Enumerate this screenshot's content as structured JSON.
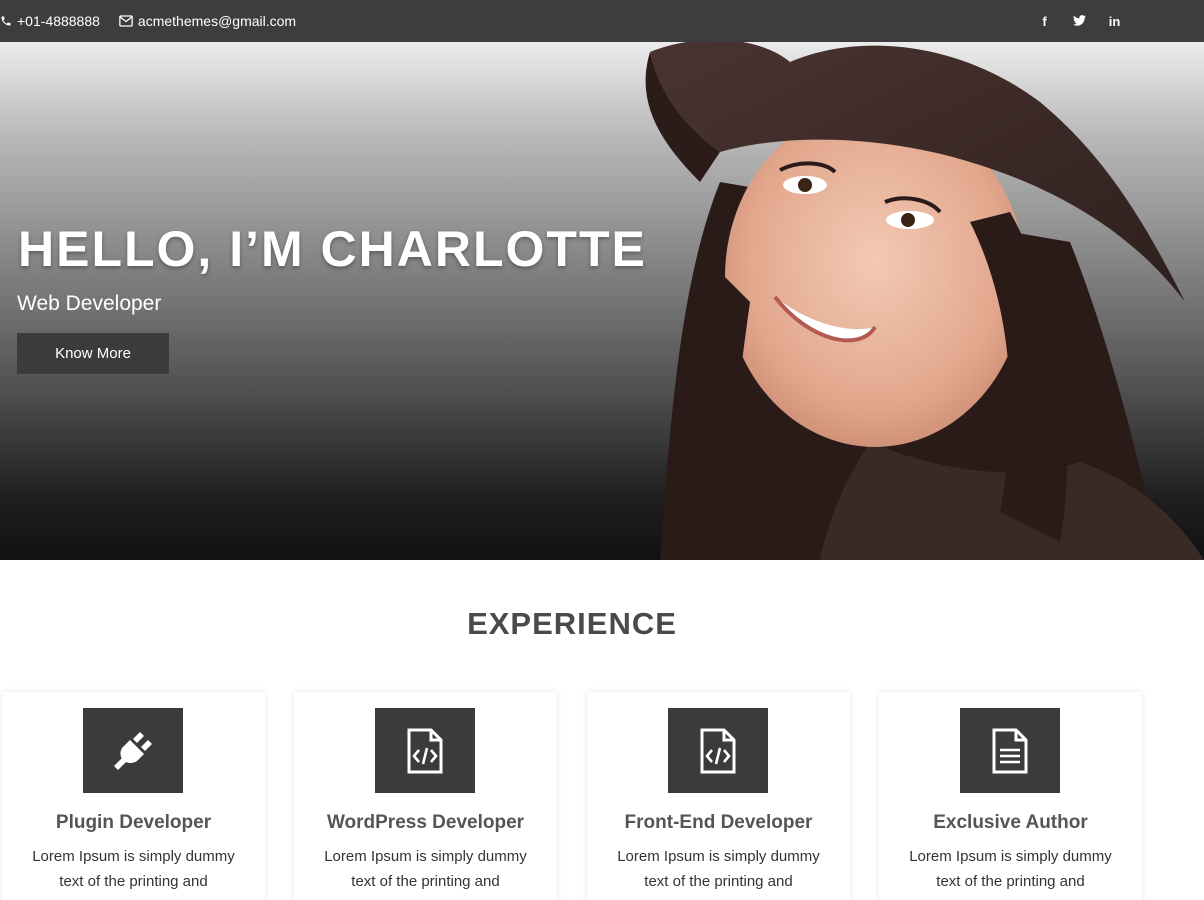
{
  "topbar": {
    "phone": "+01-4888888",
    "email": "acmethemes@gmail.com",
    "social": {
      "facebook": "f",
      "twitter": "t",
      "linkedin": "in"
    }
  },
  "hero": {
    "title": "HELLO, I’M CHARLOTTE",
    "subtitle": "Web Developer",
    "button_label": "Know More"
  },
  "experience": {
    "title": "EXPERIENCE",
    "cards": [
      {
        "icon": "plug-icon",
        "title": "Plugin Developer",
        "text": "Lorem Ipsum is simply dummy text of the printing and typesetting industry."
      },
      {
        "icon": "code-file-icon",
        "title": "WordPress Developer",
        "text": "Lorem Ipsum is simply dummy text of the printing and typesetting industry."
      },
      {
        "icon": "code-file-icon",
        "title": "Front-End Developer",
        "text": "Lorem Ipsum is simply dummy text of the printing and typesetting industry."
      },
      {
        "icon": "document-icon",
        "title": "Exclusive Author",
        "text": "Lorem Ipsum is simply dummy text of the printing and typesetting industry."
      }
    ]
  },
  "colors": {
    "topbar_bg": "#3d3d3d",
    "accent_dark": "#3b3b3b",
    "heading": "#4a4a4a"
  }
}
